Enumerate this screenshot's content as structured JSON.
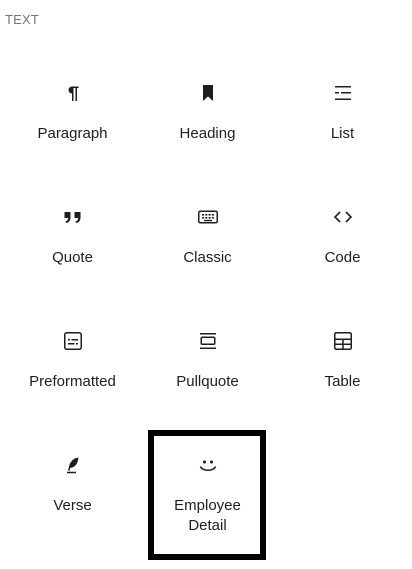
{
  "section": {
    "title": "TEXT"
  },
  "blocks": [
    {
      "label": "Paragraph",
      "icon": "paragraph-icon"
    },
    {
      "label": "Heading",
      "icon": "bookmark-icon"
    },
    {
      "label": "List",
      "icon": "list-icon"
    },
    {
      "label": "Quote",
      "icon": "quote-icon"
    },
    {
      "label": "Classic",
      "icon": "keyboard-icon"
    },
    {
      "label": "Code",
      "icon": "code-icon"
    },
    {
      "label": "Preformatted",
      "icon": "preformatted-icon"
    },
    {
      "label": "Pullquote",
      "icon": "pullquote-icon"
    },
    {
      "label": "Table",
      "icon": "table-icon"
    },
    {
      "label": "Verse",
      "icon": "feather-icon"
    },
    {
      "label": "Employee Detail",
      "icon": "smiley-icon",
      "selected": true
    }
  ],
  "colors": {
    "text": "#1e1e1e",
    "muted": "#757575",
    "selection": "#000000"
  }
}
